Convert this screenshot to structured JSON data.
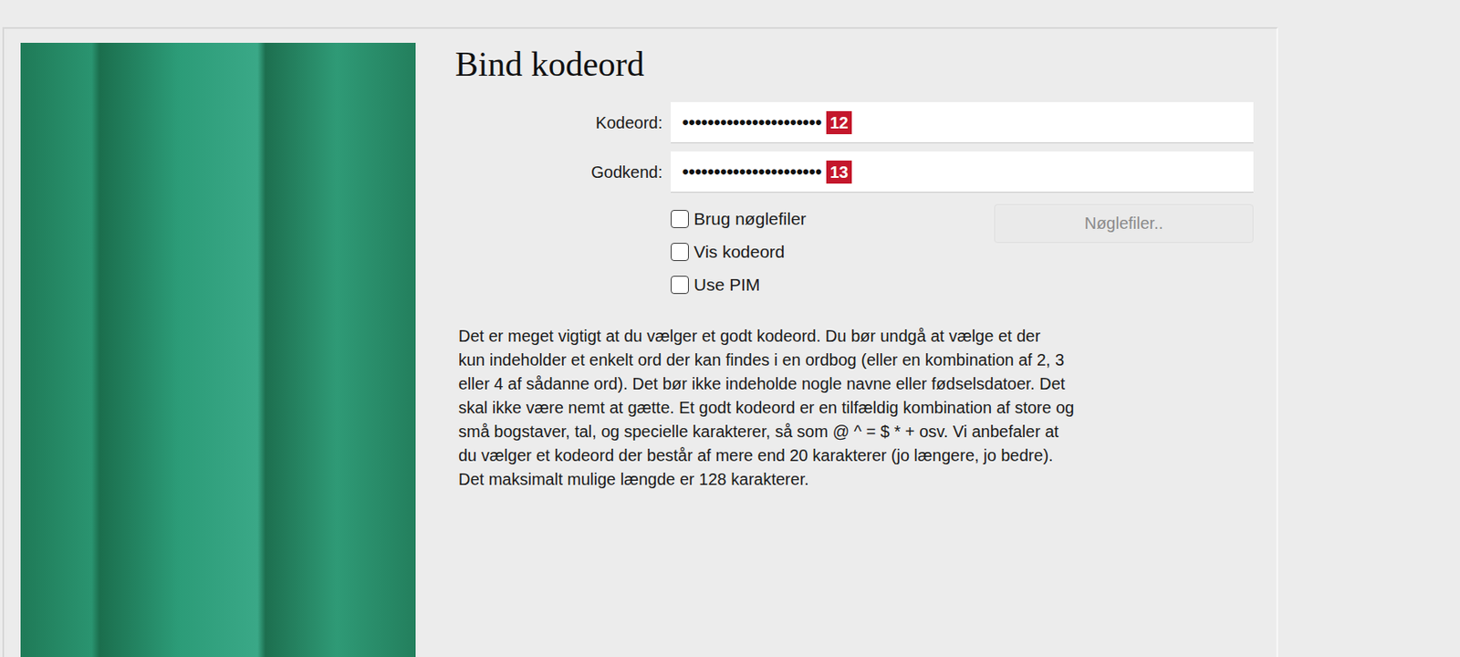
{
  "dialog": {
    "title": "Bind kodeord"
  },
  "fields": [
    {
      "label": "Kodeord:",
      "value": "••••••••••••••••••••••",
      "badge": "12"
    },
    {
      "label": "Godkend:",
      "value": "••••••••••••••••••••••",
      "badge": "13"
    }
  ],
  "checkboxes": [
    {
      "label": "Brug nøglefiler",
      "checked": false
    },
    {
      "label": "Vis kodeord",
      "checked": false
    },
    {
      "label": "Use PIM",
      "checked": false
    }
  ],
  "buttons": [
    {
      "label": "Nøglefiler..",
      "disabled": true
    }
  ],
  "description_lines": [
    "Det er meget vigtigt at du vælger et godt kodeord. Du bør undgå at vælge et der",
    "kun indeholder et enkelt ord der kan findes i en ordbog (eller en kombination af 2, 3",
    "eller 4 af sådanne ord). Det bør ikke indeholde nogle navne eller fødselsdatoer. Det",
    "skal ikke være nemt at gætte. Et godt kodeord er en tilfældig kombination af store og",
    "små bogstaver, tal, og specielle karakterer, så som @ ^ = $ * + osv. Vi anbefaler at",
    "du vælger et kodeord der består af mere end 20 karakterer (jo længere, jo bedre).",
    "Det maksimalt mulige længde er 128 karakterer."
  ]
}
